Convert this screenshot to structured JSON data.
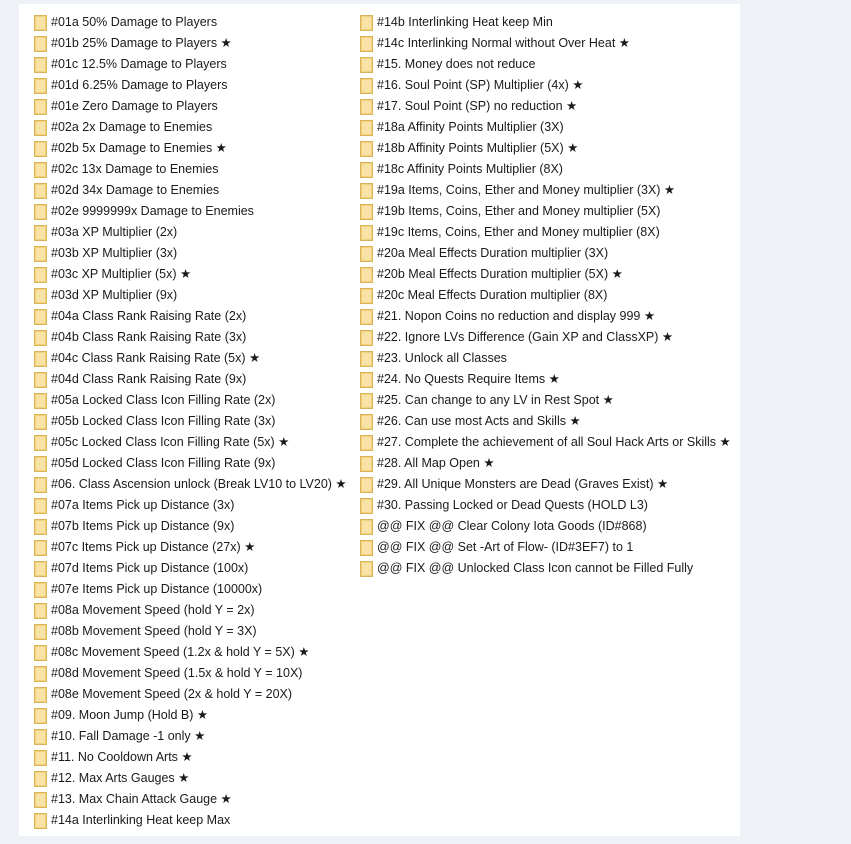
{
  "folders_left": [
    "#01a 50% Damage to Players",
    "#01b 25% Damage to Players ★",
    "#01c 12.5% Damage to Players",
    "#01d 6.25% Damage to Players",
    "#01e Zero Damage to Players",
    "#02a 2x Damage to Enemies",
    "#02b 5x Damage to Enemies ★",
    "#02c 13x Damage to Enemies",
    "#02d 34x Damage to Enemies",
    "#02e 9999999x Damage to Enemies",
    "#03a XP Multiplier (2x)",
    "#03b XP Multiplier (3x)",
    "#03c XP Multiplier (5x) ★",
    "#03d XP Multiplier (9x)",
    "#04a Class Rank Raising Rate (2x)",
    "#04b Class Rank Raising Rate (3x)",
    "#04c Class Rank Raising Rate (5x) ★",
    "#04d Class Rank Raising Rate (9x)",
    "#05a Locked Class Icon Filling Rate (2x)",
    "#05b Locked Class Icon Filling Rate (3x)",
    "#05c Locked Class Icon Filling Rate (5x) ★",
    "#05d Locked Class Icon Filling Rate (9x)",
    "#06. Class Ascension unlock (Break LV10 to LV20) ★",
    "#07a Items Pick up Distance (3x)",
    "#07b Items Pick up Distance (9x)",
    "#07c Items Pick up Distance (27x) ★",
    "#07d Items Pick up Distance (100x)",
    "#07e Items Pick up Distance (10000x)",
    "#08a Movement Speed (hold Y = 2x)",
    "#08b Movement Speed (hold Y = 3X)",
    "#08c Movement Speed (1.2x & hold Y = 5X) ★",
    "#08d Movement Speed (1.5x & hold Y = 10X)",
    "#08e Movement Speed (2x & hold Y = 20X)",
    "#09. Moon Jump (Hold B) ★",
    "#10. Fall Damage -1 only ★",
    "#11. No Cooldown Arts ★",
    "#12. Max Arts Gauges ★",
    "#13. Max Chain Attack Gauge ★",
    "#14a Interlinking Heat keep Max"
  ],
  "folders_right": [
    "#14b Interlinking Heat keep Min",
    "#14c Interlinking Normal without Over Heat ★",
    "#15. Money does not reduce",
    "#16. Soul Point (SP) Multiplier (4x) ★",
    "#17. Soul Point (SP) no reduction ★",
    "#18a Affinity Points Multiplier (3X)",
    "#18b Affinity Points Multiplier (5X) ★",
    "#18c Affinity Points Multiplier (8X)",
    "#19a Items, Coins, Ether and Money multiplier (3X) ★",
    "#19b Items, Coins, Ether and Money multiplier (5X)",
    "#19c Items, Coins, Ether and Money multiplier (8X)",
    "#20a Meal Effects Duration multiplier (3X)",
    "#20b Meal Effects Duration multiplier (5X) ★",
    "#20c Meal Effects Duration multiplier (8X)",
    "#21. Nopon Coins no reduction and display 999 ★",
    "#22. Ignore LVs Difference (Gain XP and ClassXP) ★",
    "#23. Unlock all Classes",
    "#24. No Quests Require Items ★",
    "#25. Can change to any LV in Rest Spot ★",
    "#26. Can use most Acts and Skills ★",
    "#27. Complete the achievement of all Soul Hack Arts or Skills ★",
    "#28. All Map Open ★",
    "#29. All Unique Monsters are Dead (Graves Exist) ★",
    "#30. Passing Locked or Dead Quests (HOLD L3)",
    "@@ FIX @@ Clear Colony Iota Goods (ID#868)",
    "@@ FIX @@ Set -Art of Flow- (ID#3EF7) to 1",
    "@@ FIX @@ Unlocked Class Icon cannot be Filled Fully"
  ],
  "colors": {
    "background": "#eef1f5",
    "panel": "#ffffff",
    "folder": "#f3d27e",
    "text": "#1a1a1a"
  },
  "icons": {
    "folder": "folder-icon"
  }
}
